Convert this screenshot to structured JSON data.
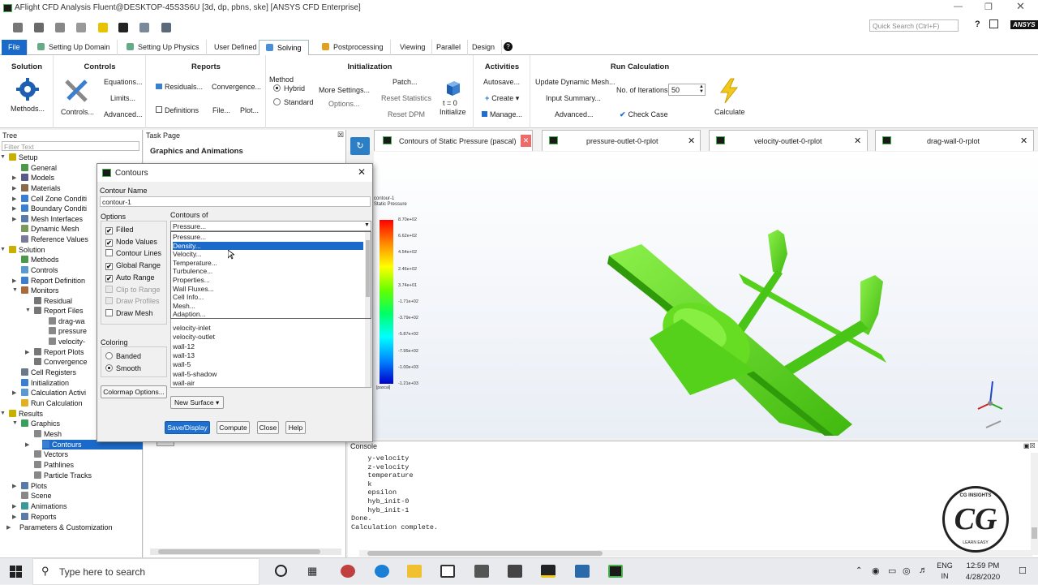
{
  "window": {
    "title": "AFlight CFD Analysis Fluent@DESKTOP-45S3S6U  [3d, dp, pbns, ske] [ANSYS CFD Enterprise]"
  },
  "quick_search": {
    "placeholder": "Quick Search (Ctrl+F)"
  },
  "brand": "ANSYS",
  "ribbon_tabs": [
    {
      "label": "File"
    },
    {
      "label": "Setting Up Domain"
    },
    {
      "label": "Setting Up Physics"
    },
    {
      "label": "User Defined"
    },
    {
      "label": "Solving"
    },
    {
      "label": "Postprocessing"
    },
    {
      "label": "Viewing"
    },
    {
      "label": "Parallel"
    },
    {
      "label": "Design"
    }
  ],
  "ribbon": {
    "solution": {
      "title": "Solution",
      "methods": "Methods..."
    },
    "controls": {
      "title": "Controls",
      "controls": "Controls...",
      "equations": "Equations...",
      "limits": "Limits...",
      "advanced": "Advanced..."
    },
    "reports": {
      "title": "Reports",
      "residuals": "Residuals...",
      "convergence": "Convergence...",
      "definitions": "Definitions",
      "file": "File...",
      "plot": "Plot..."
    },
    "initialization": {
      "title": "Initialization",
      "method_label": "Method",
      "hybrid": "Hybrid",
      "standard": "Standard",
      "more_settings": "More Settings...",
      "options": "Options...",
      "patch": "Patch...",
      "reset_statistics": "Reset Statistics",
      "reset_dpm": "Reset DPM",
      "t0": "t = 0",
      "initialize": "Initialize"
    },
    "activities": {
      "title": "Activities",
      "autosave": "Autosave...",
      "create": "Create",
      "manage": "Manage..."
    },
    "run_calculation": {
      "title": "Run Calculation",
      "update_dynamic_mesh": "Update Dynamic Mesh...",
      "input_summary": "Input Summary...",
      "advanced": "Advanced...",
      "iterations_label": "No. of Iterations",
      "iterations_value": "50",
      "check_case": "Check Case",
      "calculate": "Calculate"
    }
  },
  "tree": {
    "header": "Tree",
    "filter_placeholder": "Filter Text",
    "items": [
      {
        "label": "Setup"
      },
      {
        "label": "General"
      },
      {
        "label": "Models"
      },
      {
        "label": "Materials"
      },
      {
        "label": "Cell Zone Conditi"
      },
      {
        "label": "Boundary Conditi"
      },
      {
        "label": "Mesh Interfaces"
      },
      {
        "label": "Dynamic Mesh"
      },
      {
        "label": "Reference Values"
      },
      {
        "label": "Solution"
      },
      {
        "label": "Methods"
      },
      {
        "label": "Controls"
      },
      {
        "label": "Report Definition"
      },
      {
        "label": "Monitors"
      },
      {
        "label": "Residual"
      },
      {
        "label": "Report Files"
      },
      {
        "label": "drag-wa"
      },
      {
        "label": "pressure"
      },
      {
        "label": "velocity-"
      },
      {
        "label": "Report Plots"
      },
      {
        "label": "Convergence"
      },
      {
        "label": "Cell Registers"
      },
      {
        "label": "Initialization"
      },
      {
        "label": "Calculation Activi"
      },
      {
        "label": "Run Calculation"
      },
      {
        "label": "Results"
      },
      {
        "label": "Graphics"
      },
      {
        "label": "Mesh"
      },
      {
        "label": "Contours"
      },
      {
        "label": "Vectors"
      },
      {
        "label": "Pathlines"
      },
      {
        "label": "Particle Tracks"
      },
      {
        "label": "Plots"
      },
      {
        "label": "Scene"
      },
      {
        "label": "Animations"
      },
      {
        "label": "Reports"
      },
      {
        "label": "Parameters & Customization"
      }
    ]
  },
  "task_page": {
    "header": "Task Page",
    "section": "Graphics and Animations"
  },
  "graphics_tabs": [
    {
      "label": "Contours of Static Pressure (pascal)"
    },
    {
      "label": "pressure-outlet-0-rplot"
    },
    {
      "label": "velocity-outlet-0-rplot"
    },
    {
      "label": "drag-wall-0-rplot"
    }
  ],
  "colorbar": {
    "title_line1": "contour-1",
    "title_line2": "Static Pressure",
    "unit": "[pascal]",
    "labels": [
      "8.70e+02",
      "6.62e+02",
      "4.54e+02",
      "2.46e+02",
      "3.74e+01",
      "-1.71e+02",
      "-3.79e+02",
      "-5.87e+02",
      "-7.95e+02",
      "-1.00e+03",
      "-1.21e+03"
    ]
  },
  "console": {
    "header": "Console",
    "lines": [
      "    y-velocity",
      "    z-velocity",
      "    temperature",
      "    k",
      "    epsilon",
      "    hyb_init-0",
      "    hyb_init-1",
      "Done.",
      "",
      "Calculation complete."
    ]
  },
  "dialog": {
    "title": "Contours",
    "contour_name_label": "Contour Name",
    "contour_name_value": "contour-1",
    "options_label": "Options",
    "options": [
      {
        "label": "Filled",
        "checked": true,
        "enabled": true
      },
      {
        "label": "Node Values",
        "checked": true,
        "enabled": true
      },
      {
        "label": "Contour Lines",
        "checked": false,
        "enabled": true
      },
      {
        "label": "Global Range",
        "checked": true,
        "enabled": true
      },
      {
        "label": "Auto Range",
        "checked": true,
        "enabled": true
      },
      {
        "label": "Clip to Range",
        "checked": false,
        "enabled": false
      },
      {
        "label": "Draw Profiles",
        "checked": false,
        "enabled": false
      },
      {
        "label": "Draw Mesh",
        "checked": false,
        "enabled": true
      }
    ],
    "coloring_label": "Coloring",
    "coloring": [
      {
        "label": "Banded",
        "selected": false
      },
      {
        "label": "Smooth",
        "selected": true
      }
    ],
    "colormap_button": "Colormap Options...",
    "contours_of_label": "Contours of",
    "contours_of_value": "Pressure...",
    "dropdown_items": [
      "Pressure...",
      "Density...",
      "Velocity...",
      "Temperature...",
      "Turbulence...",
      "Properties...",
      "Wall Fluxes...",
      "Cell Info...",
      "Mesh...",
      "Adaption..."
    ],
    "dropdown_selected": "Density...",
    "surfaces": [
      "velocity-inlet",
      "velocity-outlet",
      "wall-12",
      "wall-13",
      "wall-5",
      "wall-5-shadow",
      "wall-air"
    ],
    "new_surface": "New Surface",
    "buttons": {
      "save_display": "Save/Display",
      "compute": "Compute",
      "close": "Close",
      "help": "Help"
    }
  },
  "watermark": {
    "text": "CG",
    "top": "CG INSIGHTS",
    "bottom": "LEARN EASY"
  },
  "taskbar": {
    "search_placeholder": "Type here to search",
    "lang": "ENG",
    "region": "IN",
    "time": "12:59 PM",
    "date": "4/28/2020"
  },
  "colors": {
    "accent": "#1b6ac9",
    "model": "#66dd22"
  }
}
